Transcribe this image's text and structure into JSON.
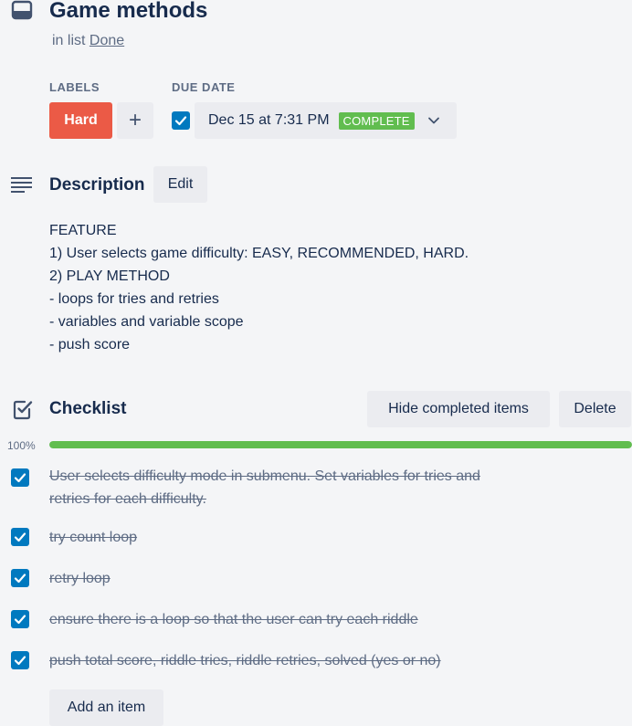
{
  "card": {
    "title": "Game methods",
    "in_list_prefix": "in list",
    "list_name": "Done"
  },
  "labels": {
    "heading": "LABELS",
    "items": [
      {
        "name": "Hard",
        "color": "#eb5a46"
      }
    ],
    "add_symbol": "+"
  },
  "due_date": {
    "heading": "DUE DATE",
    "checked": true,
    "value": "Dec 15 at 7:31 PM",
    "status": "COMPLETE",
    "status_color": "#61bd4f"
  },
  "description": {
    "heading": "Description",
    "edit_label": "Edit",
    "lines": [
      "FEATURE",
      "1) User selects game difficulty: EASY, RECOMMENDED, HARD.",
      "2) PLAY METHOD",
      "- loops for tries and retries",
      "- variables and variable scope",
      "- push score"
    ]
  },
  "checklist": {
    "heading": "Checklist",
    "hide_label": "Hide completed items",
    "delete_label": "Delete",
    "progress_text": "100%",
    "progress_fraction": 1.0,
    "progress_color": "#61bd4f",
    "items": [
      {
        "text_line1": "User selects difficulty mode in submenu. Set variables for tries and",
        "text_line2": "retries for each difficulty.",
        "checked": true
      },
      {
        "text_line1": "try count loop",
        "text_line2": "",
        "checked": true
      },
      {
        "text_line1": "retry loop",
        "text_line2": "",
        "checked": true
      },
      {
        "text_line1": "ensure there is a loop so that the user can try each riddle",
        "text_line2": "",
        "checked": true
      },
      {
        "text_line1": "push total score, riddle tries, riddle retries, solved (yes or no)",
        "text_line2": "",
        "checked": true
      }
    ],
    "add_item_label": "Add an item"
  },
  "colors": {
    "accent_blue": "#0079bf",
    "text_primary": "#172b4d",
    "text_secondary": "#5e6c84",
    "button_bg": "#ebecf0"
  }
}
